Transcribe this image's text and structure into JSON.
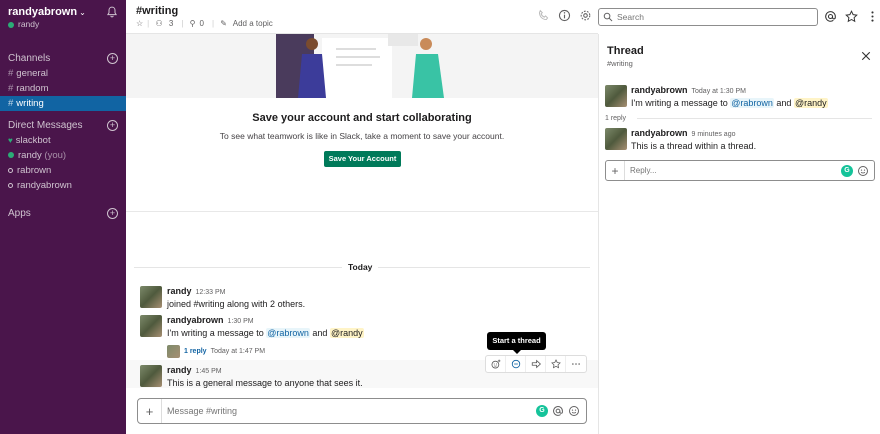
{
  "workspace": {
    "name": "randyabrown",
    "chevron": "⌄",
    "user": "randy"
  },
  "sidebar": {
    "channels_title": "Channels",
    "channels": [
      {
        "label": "general"
      },
      {
        "label": "random"
      },
      {
        "label": "writing"
      }
    ],
    "dm_title": "Direct Messages",
    "dms": [
      {
        "label": "slackbot"
      },
      {
        "label": "randy",
        "suffix": "(you)"
      },
      {
        "label": "rabrown"
      },
      {
        "label": "randyabrown"
      }
    ],
    "apps_title": "Apps"
  },
  "channel": {
    "title": "#writing",
    "members": "3",
    "pins": "0",
    "topic": "Add a topic"
  },
  "search": {
    "placeholder": "Search"
  },
  "banner": {
    "title": "Save your account and start collaborating",
    "text": "To see what teamwork is like in Slack, take a moment to save your account.",
    "button": "Save Your Account"
  },
  "day_label": "Today",
  "messages": [
    {
      "name": "randy",
      "time": "12:33 PM",
      "text": "joined #writing along with 2 others."
    },
    {
      "name": "randyabrown",
      "time": "1:30 PM",
      "text_pre": "I'm writing a message to ",
      "mention1": "@rabrown",
      "text_mid": " and ",
      "mention2": "@randy",
      "reply_link": "1 reply",
      "reply_time": "Today at 1:47 PM"
    },
    {
      "name": "randy",
      "time": "1:45 PM",
      "text": "This is a general message to anyone that sees it."
    }
  ],
  "tooltip": "Start a thread",
  "composer": {
    "placeholder": "Message #writing"
  },
  "thread": {
    "title": "Thread",
    "subtitle": "#writing",
    "parent": {
      "name": "randyabrown",
      "time": "Today at 1:30 PM",
      "text_pre": "I'm writing a message to ",
      "mention1": "@rabrown",
      "text_mid": " and ",
      "mention2": "@randy"
    },
    "reply_count": "1 reply",
    "reply": {
      "name": "randyabrown",
      "time": "9 minutes ago",
      "text": "This is a thread within a thread."
    },
    "reply_placeholder": "Reply..."
  },
  "grammarly_letter": "G",
  "colors": {
    "sidebar": "#4a154b",
    "active_channel": "#1164a3",
    "button": "#007a5a",
    "presence": "#2bac76"
  }
}
